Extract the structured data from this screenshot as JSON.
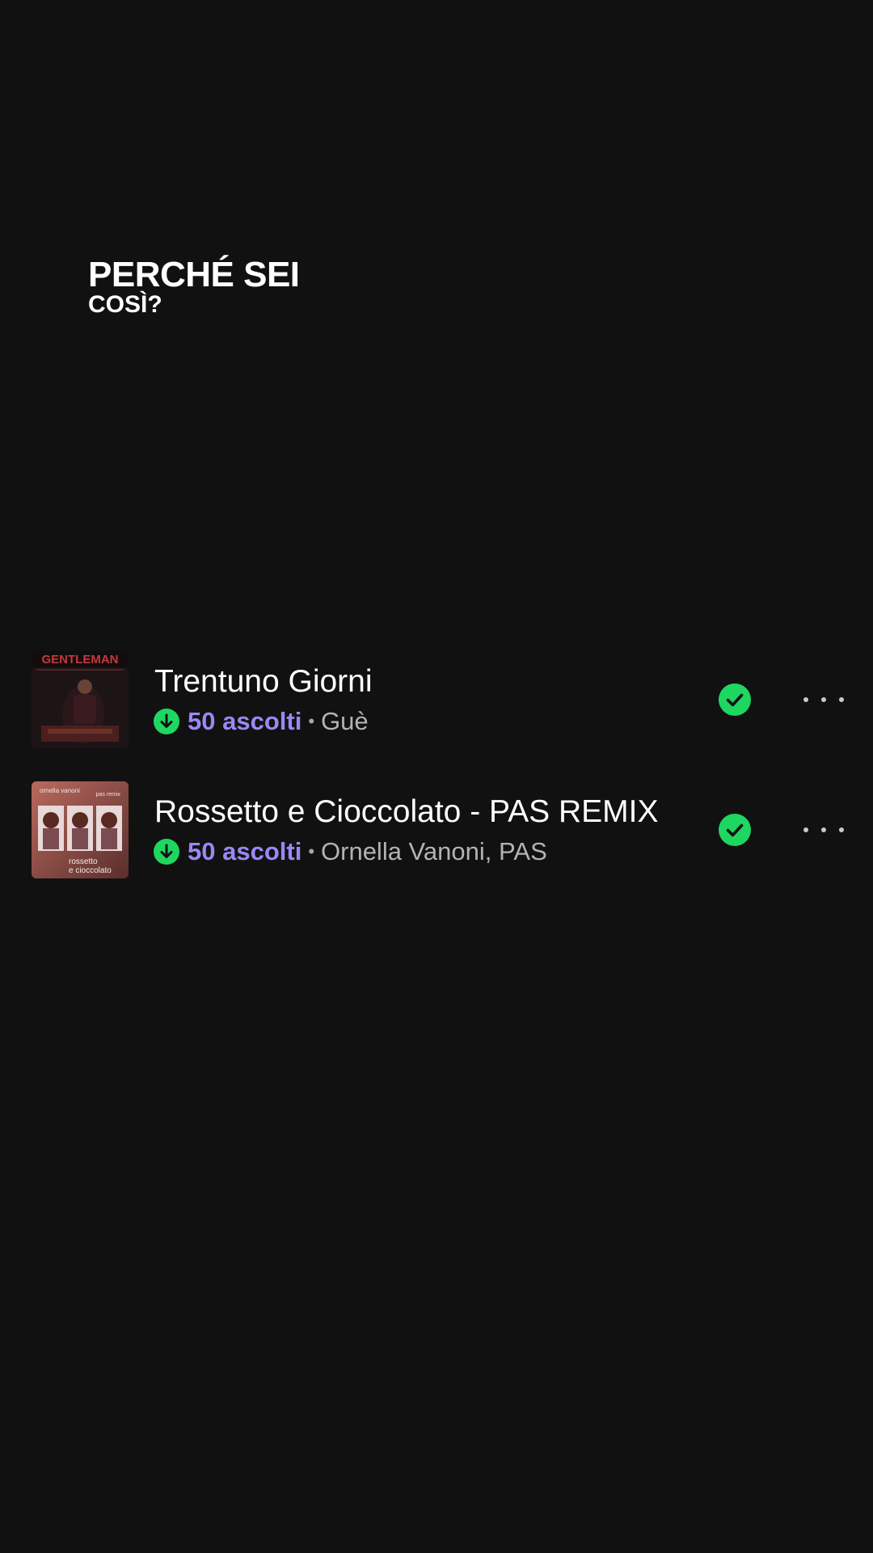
{
  "header": {
    "title_line1": "PERCHÉ SEI",
    "title_line2": "COSÌ?"
  },
  "tracks": [
    {
      "title": "Trentuno Giorni",
      "plays": "50 ascolti",
      "separator": "•",
      "artist": "Guè",
      "cover_text": "GENTLEMAN",
      "downloaded": true,
      "added": true
    },
    {
      "title": "Rossetto e Cioccolato - PAS REMIX",
      "plays": "50 ascolti",
      "separator": "•",
      "artist": "Ornella Vanoni, PAS",
      "cover_text_top_left": "ornella vanoni",
      "cover_text_top_right": "pas remix",
      "cover_text_bottom_1": "rossetto",
      "cover_text_bottom_2": "e cioccolato",
      "downloaded": true,
      "added": true
    }
  ],
  "colors": {
    "background": "#121111",
    "accent_green": "#1ed760",
    "plays_purple": "#9b87f5",
    "secondary_text": "#b3b3b3"
  },
  "icons": {
    "download": "download-circle-icon",
    "added": "check-circle-icon",
    "more": "more-horizontal-icon"
  }
}
